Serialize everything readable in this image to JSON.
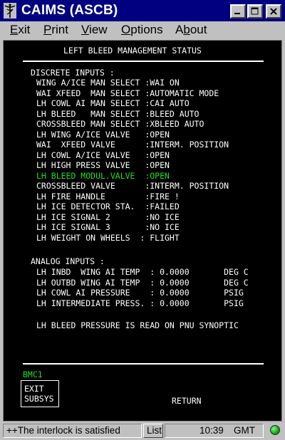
{
  "window": {
    "title": "CAIMS (ASCB)",
    "icon": "caduceus-icon"
  },
  "menu": {
    "exit": "Exit",
    "print": "Print",
    "view": "View",
    "options": "Options",
    "about": "About"
  },
  "screen": {
    "heading": "LEFT BLEED MANAGEMENT STATUS",
    "discrete_title": "DISCRETE INPUTS :",
    "discrete_rows": [
      "WING A/ICE MAN SELECT :WAI ON",
      "WAI XFEED  MAN SELECT :AUTOMATIC MODE",
      "LH COWL AI MAN SELECT :CAI AUTO",
      "LH BLEED   MAN SELECT :BLEED AUTO",
      "CROSSBLEED MAN SELECT :XBLEED AUTO",
      "LH WING A/ICE VALVE   :OPEN",
      "WAI  XFEED VALVE      :INTERM. POSITION",
      "LH COWL A/ICE VALVE   :OPEN",
      "LH HIGH PRESS VALVE   :OPEN",
      "LH BLEED MODUL.VALVE  :OPEN",
      "CROSSBLEED VALVE      :INTERM. POSITION",
      "LH FIRE HANDLE        :FIRE !",
      "LH ICE DETECTOR STA.  :FAILED",
      "LH ICE SIGNAL 2       :NO ICE",
      "LH ICE SIGNAL 3       :NO ICE",
      "LH WEIGHT ON WHEELS  : FLIGHT"
    ],
    "analog_title": "ANALOG INPUTS :",
    "analog_rows": [
      "LH INBD  WING AI TEMP  : 0.0000       DEG C",
      "LH OUTBD WING AI TEMP  : 0.0000       DEG C",
      "LH COWL AI PRESSURE    : 0.0000       PSIG",
      "LH INTERMEDIATE PRESS. : 0.0000       PSIG"
    ],
    "note": "LH BLEED PRESSURE IS READ ON PNU SYNOPTIC",
    "bmc_label": "BMC1",
    "exit_line1": "EXIT",
    "exit_line2": "SUBSYS",
    "return_label": "RETURN",
    "highlight_color": "#22dd22"
  },
  "status": {
    "message": "++The interlock is satisfied",
    "list_button": "List",
    "time": "10:39",
    "timezone": "GMT",
    "led_color": "#11a311"
  }
}
